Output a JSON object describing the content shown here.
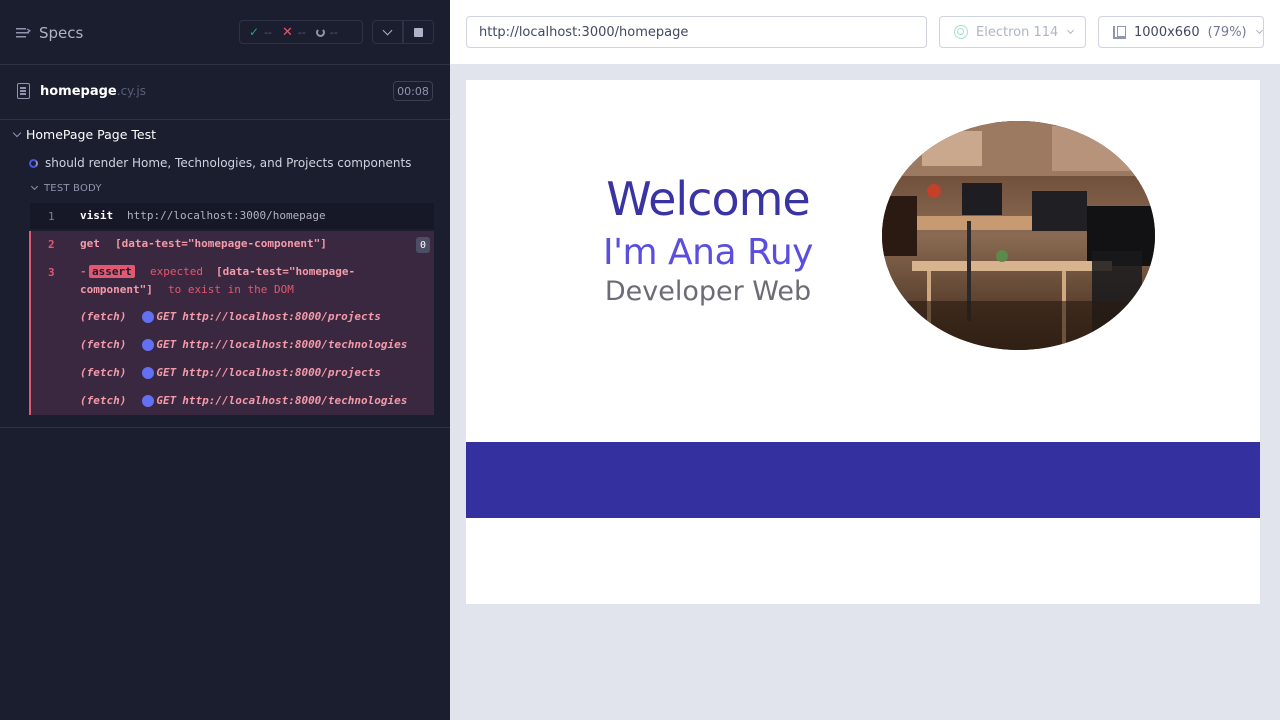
{
  "reporter": {
    "specs_label": "Specs",
    "stats": {
      "passed": "--",
      "failed": "--",
      "pending": "--"
    },
    "spec": {
      "name": "homepage",
      "ext": ".cy.js",
      "time": "00:08"
    },
    "suite_title": "HomePage Page Test",
    "test_title": "should render Home, Technologies, and Projects components",
    "test_body_label": "TEST BODY",
    "commands": [
      {
        "num": "1",
        "name": "visit",
        "message": "http://localhost:3000/homepage"
      },
      {
        "num": "2",
        "name": "get",
        "message": "[data-test=\"homepage-component\"]",
        "badge": "0"
      },
      {
        "num": "3",
        "dash": "-",
        "name": "assert",
        "msg_a": "expected",
        "msg_b": "[data-test=\"homepage-",
        "msg_c": "component\"]",
        "msg_d": "to exist in the DOM"
      }
    ],
    "requests": [
      {
        "type": "(fetch)",
        "method": "GET",
        "url": "http://localhost:8000/projects"
      },
      {
        "type": "(fetch)",
        "method": "GET",
        "url": "http://localhost:8000/technologies"
      },
      {
        "type": "(fetch)",
        "method": "GET",
        "url": "http://localhost:8000/projects"
      },
      {
        "type": "(fetch)",
        "method": "GET",
        "url": "http://localhost:8000/technologies"
      }
    ]
  },
  "aut": {
    "url": "http://localhost:3000/homepage",
    "browser": "Electron 114",
    "viewport": "1000x660",
    "zoom": "(79%)"
  },
  "app": {
    "welcome": "Welcome",
    "name": "I'm Ana Ruy",
    "role": "Developer Web",
    "band_color": "#3430a0"
  }
}
